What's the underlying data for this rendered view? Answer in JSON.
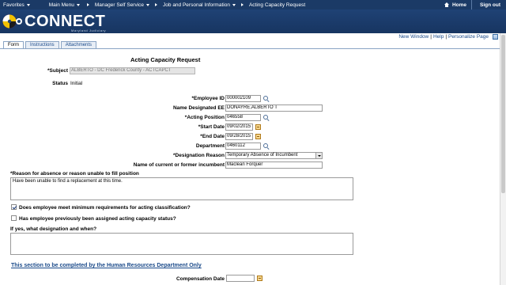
{
  "topbar": {
    "favorites": "Favorites",
    "main_menu": "Main Menu",
    "breadcrumbs": [
      "Manager Self Service",
      "Job and Personal Information",
      "Acting Capacity Request"
    ],
    "home": "Home",
    "sign_out": "Sign out"
  },
  "logo": {
    "text": "CONNECT",
    "sub": "Maryland Judiciary"
  },
  "util": {
    "new_window": "New Window",
    "help": "Help",
    "personalize": "Personalize Page"
  },
  "tabs": [
    "Form",
    "Instructions",
    "Attachments"
  ],
  "form": {
    "title": "Acting Capacity Request",
    "subject_label": "*Subject",
    "subject_value": "ALBERTO - DC Frederick County - ACTCAPCT",
    "status_label": "Status",
    "status_value": "Initial",
    "employee_id_label": "*Employee ID",
    "employee_id_value": "000002109",
    "name_designated_label": "Name Designated EE",
    "name_designated_value": "DONAYRE,ALBERTO T",
    "acting_position_label": "*Acting Position",
    "acting_position_value": "046558",
    "start_date_label": "*Start Date",
    "start_date_value": "09/02/2015",
    "end_date_label": "*End Date",
    "end_date_value": "09/28/2015",
    "department_label": "Department",
    "department_value": "0460112",
    "designation_reason_label": "*Designation Reason",
    "designation_reason_value": "Temporary Absence of Incumbent",
    "incumbent_label": "Name of current or former incumbent",
    "incumbent_value": "Maclean Forquer",
    "reason_label": "*Reason for absence or reason unable to fill position",
    "reason_value": "Have been unable to find a replacement at this time.",
    "min_req_label": "Does employee meet minimum requirements for acting classification?",
    "min_req_checked": true,
    "prev_assigned_label": "Has employee previously been assigned acting capacity status?",
    "prev_assigned_checked": false,
    "if_yes_label": "If yes, what designation and when?",
    "if_yes_value": "",
    "hr_section": "This section to be completed by the Human Resources Department Only",
    "compensation_date_label": "Compensation Date",
    "compensation_date_value": ""
  }
}
